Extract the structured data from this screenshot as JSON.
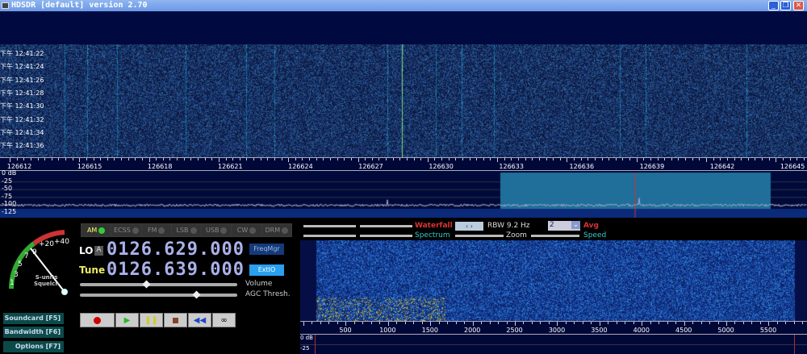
{
  "window": {
    "title": "HDSDR [default]  version 2.70",
    "controls": [
      "minimize",
      "restore",
      "close"
    ]
  },
  "waterfall": {
    "times": [
      "下午 12:41:22",
      "下午 12:41:24",
      "下午 12:41:26",
      "下午 12:41:28",
      "下午 12:41:30",
      "下午 12:41:32",
      "下午 12:41:34",
      "下午 12:41:36"
    ]
  },
  "freq_scale": {
    "labels": [
      "126612",
      "126615",
      "126618",
      "126621",
      "126624",
      "126627",
      "126630",
      "126633",
      "126636",
      "126639",
      "126642",
      "126645"
    ]
  },
  "spectrum": {
    "db_labels": [
      "0 dB",
      "-25",
      "-50",
      "-75",
      "-100",
      "-125"
    ],
    "band_color": "#1f6f9a"
  },
  "modes": [
    {
      "label": "AM",
      "active": true
    },
    {
      "label": "ECSS"
    },
    {
      "label": "FM"
    },
    {
      "label": "LSB"
    },
    {
      "label": "USB"
    },
    {
      "label": "CW"
    },
    {
      "label": "DRM"
    }
  ],
  "smeter": {
    "labels": [
      "1",
      "3",
      "5",
      "7",
      "9",
      "+20",
      "+40"
    ],
    "caption1": "S-units",
    "caption2": "Squelch"
  },
  "lo": {
    "label": "LO",
    "badge": "A",
    "value": "0126.629.000"
  },
  "tune": {
    "label": "Tune",
    "value": "0126.639.000"
  },
  "buttons": {
    "freqmgr": "FreqMgr",
    "extio": "ExtIO"
  },
  "sliders": {
    "volume": "Volume",
    "agc": "AGC Thresh.",
    "volume_level": 0.42,
    "agc_level": 0.74
  },
  "side_buttons": [
    "Soundcard [F5]",
    "Bandwidth [F6]",
    "Options   [F7]"
  ],
  "transport": [
    "record",
    "play",
    "pause",
    "stop",
    "rewind",
    "loop"
  ],
  "display_ctl": {
    "waterfall": "Waterfall",
    "spectrum": "Spectrum",
    "rbw": "RBW  9.2 Hz",
    "avg_value": "2",
    "avg": "Avg",
    "zoom": "Zoom",
    "speed": "Speed"
  },
  "audio_scale": {
    "labels": [
      "500",
      "1000",
      "1500",
      "2000",
      "2500",
      "3000",
      "3500",
      "4000",
      "4500",
      "5000",
      "5500"
    ],
    "db_labels": [
      "0 dB",
      "-25"
    ]
  }
}
